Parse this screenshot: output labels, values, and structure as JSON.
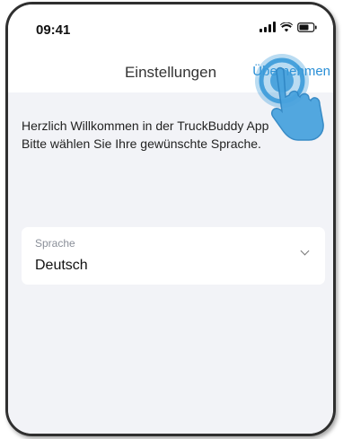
{
  "status_bar": {
    "time": "09:41",
    "icons": [
      "signal-icon",
      "wifi-icon",
      "battery-icon"
    ]
  },
  "nav": {
    "title": "Einstellungen",
    "action_label": "Übernehmen"
  },
  "content": {
    "welcome_line1": "Herzlich Willkommen in der TruckBuddy App",
    "welcome_line2": "Bitte wählen Sie Ihre gewünschte Sprache.",
    "language_select": {
      "label": "Sprache",
      "value": "Deutsch"
    }
  },
  "overlay": {
    "icon": "tap-hand-icon",
    "color": "#3a9ad9"
  },
  "colors": {
    "accent": "#2a8fd6",
    "background": "#f2f3f7"
  }
}
